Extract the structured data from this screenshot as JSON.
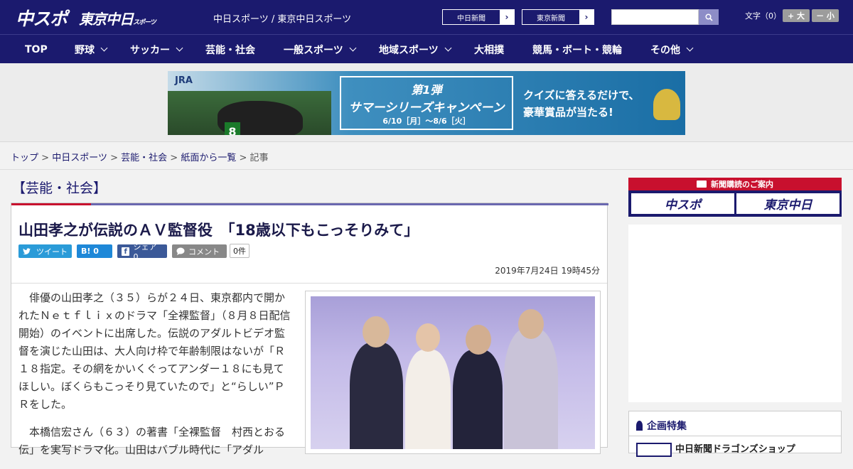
{
  "header": {
    "logo_chuspo": "中スポ",
    "logo_tokyo": "東京中日",
    "logo_tokyo_small": "スポーツ",
    "site_title": "中日スポーツ / 東京中日スポーツ",
    "btn_chunichi": "中日新聞",
    "btn_tokyo": "東京新聞",
    "search_placeholder": "",
    "fontsize_label": "文字（0）",
    "fs_large": "+ 大",
    "fs_small": "－ 小"
  },
  "nav": {
    "items": [
      {
        "label": "TOP"
      },
      {
        "label": "野球"
      },
      {
        "label": "サッカー"
      },
      {
        "label": "芸能・社会"
      },
      {
        "label": "一般スポーツ"
      },
      {
        "label": "地域スポーツ"
      },
      {
        "label": "大相撲"
      },
      {
        "label": "競馬・ボート・競輪"
      },
      {
        "label": "その他"
      }
    ]
  },
  "banner": {
    "jra": "JRA",
    "horse_number": "8",
    "campaign_line1": "第1弾",
    "campaign_line2": "サマーシリーズキャンペーン",
    "campaign_line3": "6/10［月］～8/6［火］",
    "quiz_line1": "クイズに答えるだけで、",
    "quiz_line2": "豪華賞品が当たる!"
  },
  "breadcrumb": {
    "items": [
      "トップ",
      "中日スポーツ",
      "芸能・社会",
      "紙面から一覧"
    ],
    "current": "記事",
    "sep": ">"
  },
  "category": "【芸能・社会】",
  "article": {
    "headline": "山田孝之が伝説のＡＶ監督役　「18歳以下もこっそりみて」",
    "share": {
      "tweet": "ツイート",
      "hatena": "B! 0",
      "facebook": "シェア 0",
      "comment": "コメント",
      "comment_count": "0件"
    },
    "date": "2019年7月24日 19時45分",
    "paragraphs": [
      "俳優の山田孝之（３５）らが２４日、東京都内で開かれたＮｅｔｆｌｉｘのドラマ「全裸監督」（８月８日配信開始）のイベントに出席した。伝説のアダルトビデオ監督を演じた山田は、大人向け枠で年齢制限はないが「Ｒ１８指定。その網をかいくぐってアンダー１８にも見てほしい。ぼくらもこっそり見ていたので」と“らしい”ＰＲをした。",
      "本橋信宏さん（６３）の著書「全裸監督　村西とおる伝」を実写ドラマ化。山田はバブル時代に「アダル"
    ]
  },
  "sidebar": {
    "subscribe_header": "新聞購読のご案内",
    "paper1": "中スポ",
    "paper2": "東京中日",
    "feature_title": "企画特集",
    "feature_item": "中日新聞ドラゴンズショップ"
  },
  "colors": {
    "brand_navy": "#1b1a6e",
    "accent_red": "#c8102e",
    "twitter": "#2a9bd8",
    "hatena": "#1e88d8",
    "facebook": "#3b5998",
    "comment": "#888888"
  }
}
